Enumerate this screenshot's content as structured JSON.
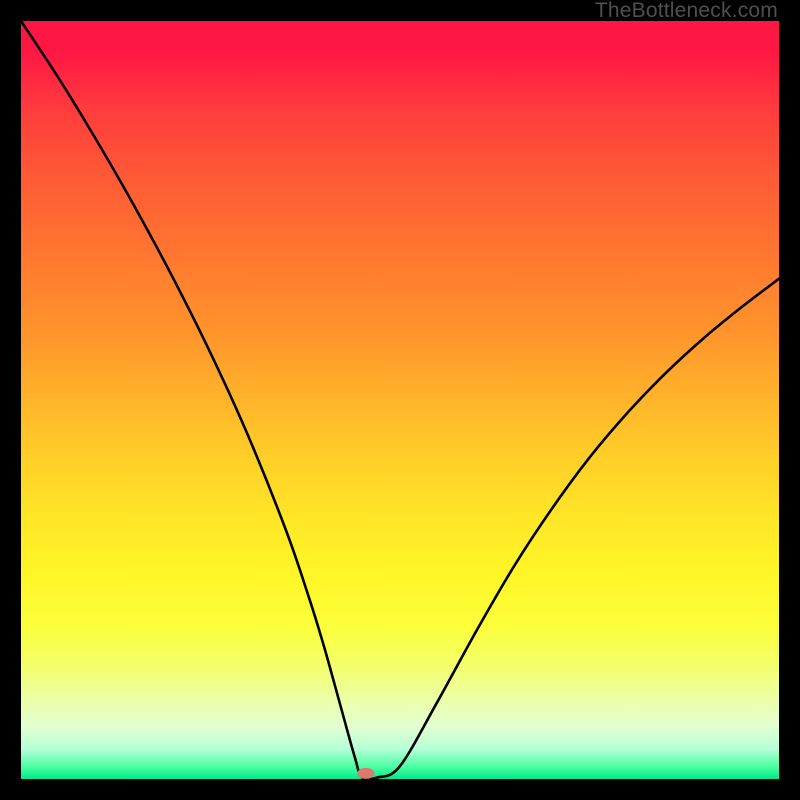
{
  "watermark": "TheBottleneck.com",
  "chart_data": {
    "type": "line",
    "title": "",
    "xlabel": "",
    "ylabel": "",
    "xlim": [
      0,
      100
    ],
    "ylim": [
      0,
      100
    ],
    "grid": false,
    "series": [
      {
        "name": "curve",
        "color": "#000000",
        "x": [
          0,
          5,
          10,
          15,
          20,
          25,
          30,
          35,
          38,
          40,
          42,
          44,
          45,
          47,
          50,
          55,
          60,
          65,
          70,
          75,
          80,
          85,
          90,
          95,
          100
        ],
        "values": [
          100,
          92.4,
          84.2,
          75.5,
          66.2,
          56.2,
          45.2,
          32.7,
          23.9,
          17.4,
          10.2,
          3.0,
          0.2,
          0.2,
          1.7,
          10.3,
          19.4,
          28.0,
          35.6,
          42.4,
          48.3,
          53.5,
          58.1,
          62.2,
          66.0
        ]
      }
    ],
    "marker": {
      "x": 45.5,
      "y": 0.75,
      "color": "#d87a6f"
    }
  },
  "colors": {
    "frame": "#000000",
    "gradient_top": "#ff1744",
    "gradient_mid": "#ffe727",
    "gradient_bottom": "#00e890",
    "curve": "#000000",
    "marker": "#d87a6f"
  }
}
